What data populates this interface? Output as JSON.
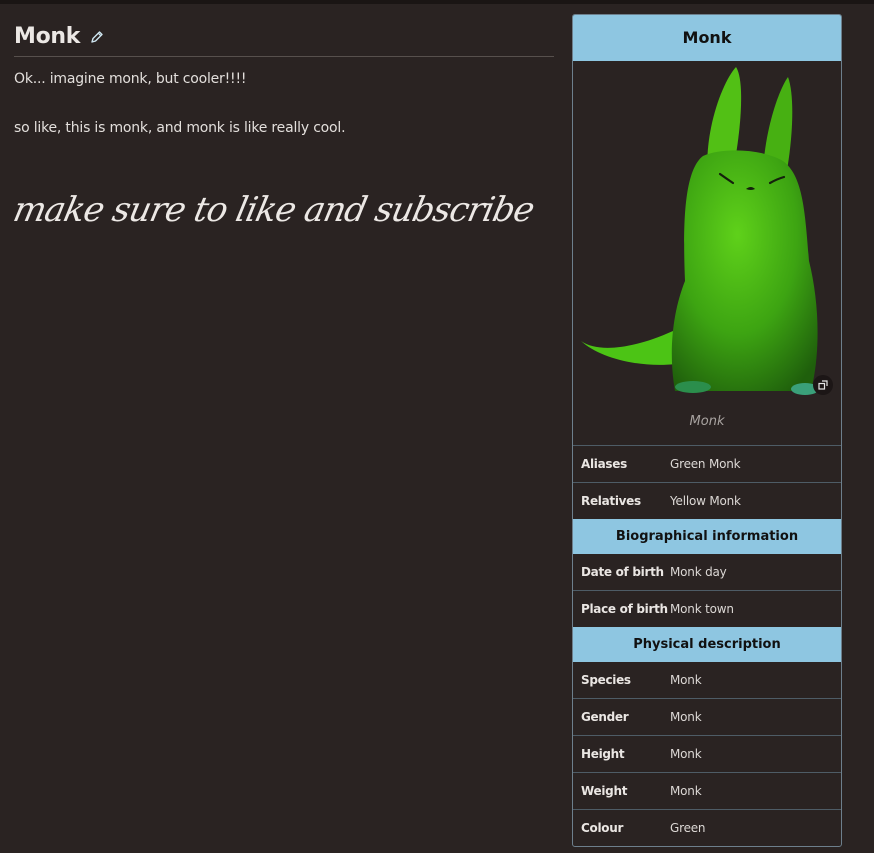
{
  "page": {
    "title": "Monk",
    "paragraphs": [
      "Ok... imagine monk, but cooler!!!!",
      "so like, this is monk, and monk is like really cool."
    ],
    "script_text": "make sure to like and subscribe"
  },
  "infobox": {
    "title": "Monk",
    "image_caption": "Monk",
    "rows_top": [
      {
        "label": "Aliases",
        "value": "Green Monk"
      },
      {
        "label": "Relatives",
        "value": "Yellow Monk"
      }
    ],
    "section_bio": "Biographical information",
    "rows_bio": [
      {
        "label": "Date of birth",
        "value": "Monk day"
      },
      {
        "label": "Place of birth",
        "value": "Monk town"
      }
    ],
    "section_physical": "Physical description",
    "rows_physical": [
      {
        "label": "Species",
        "value": "Monk"
      },
      {
        "label": "Gender",
        "value": "Monk"
      },
      {
        "label": "Height",
        "value": "Monk"
      },
      {
        "label": "Weight",
        "value": "Monk"
      },
      {
        "label": "Colour",
        "value": "Green"
      }
    ]
  },
  "icons": {
    "edit": "pencil-icon",
    "expand": "expand-icon"
  },
  "colors": {
    "background": "#2a2322",
    "infobox_header": "#8ec6e1",
    "border": "#6d7f8c"
  }
}
